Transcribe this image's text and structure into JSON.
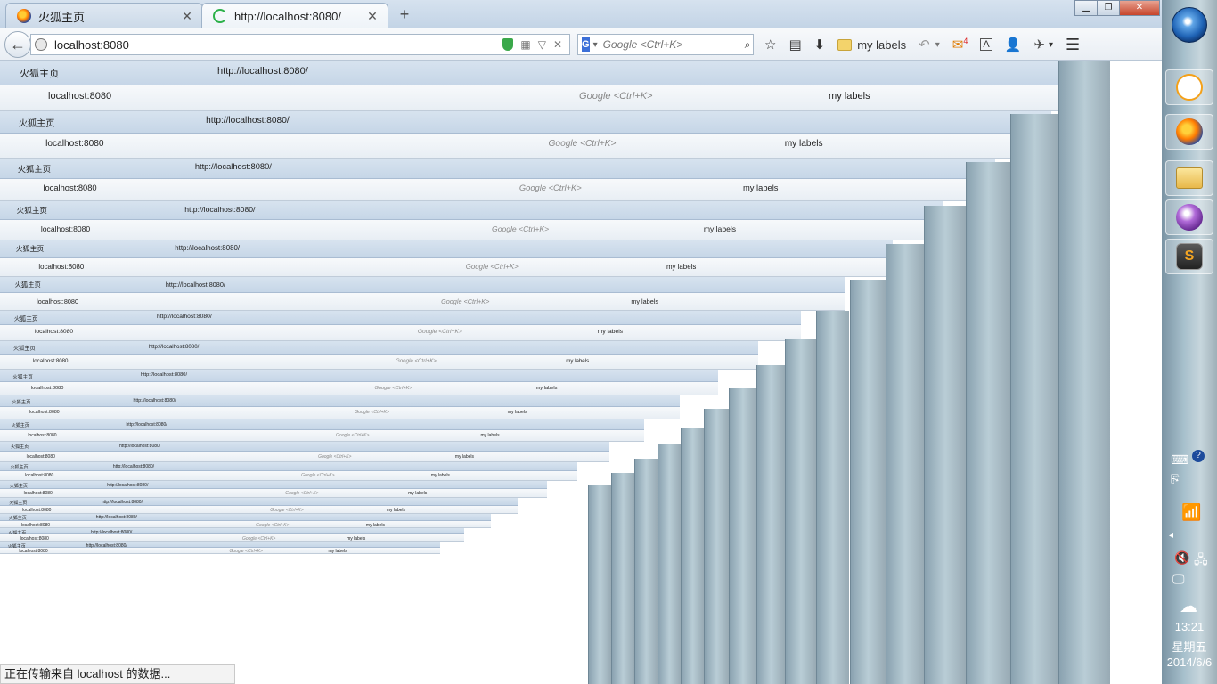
{
  "tabs": [
    {
      "title": "火狐主页",
      "close": "✕",
      "active": false
    },
    {
      "title": "http://localhost:8080/",
      "close": "✕",
      "active": true
    }
  ],
  "new_tab": "+",
  "window": {
    "minimize": "▁",
    "maximize": "❐",
    "close": "✕"
  },
  "nav": {
    "back": "←",
    "url": "localhost:8080",
    "url_host": "localhost",
    "url_port": ":8080",
    "qr": "▦",
    "dropdown": "▽",
    "clear": "✕",
    "search_engine_label": "G",
    "search_engine_arrow": "▾",
    "search_placeholder": "Google <Ctrl+K>",
    "search_go": "⌕",
    "bookmark_star": "☆",
    "reading_list": "▤",
    "downloads": "⬇",
    "bookmarks_folder_label": "my labels",
    "undo": "↶",
    "undo_arrow": "▾",
    "mail": "✉",
    "mail_badge": "4",
    "reader": "A",
    "account": "👤",
    "addon": "✈",
    "addon_arrow": "▾",
    "menu": "☰"
  },
  "echo_levels": [
    {
      "tab1": "火狐主页",
      "tab2": "http://localhost:8080/",
      "url": "localhost:8080",
      "search": "Google <Ctrl+K>",
      "labels": "my labels"
    }
  ],
  "status_text": "正在传输来自 localhost 的数据...",
  "taskbar": {
    "start_label": "",
    "time": "13:21",
    "weekday": "星期五",
    "date": "2014/6/6",
    "sub_glyph": "S"
  },
  "colors": {
    "accent": "#2db14a",
    "titlebar": "#cbd9e8",
    "close": "#c7452c"
  }
}
